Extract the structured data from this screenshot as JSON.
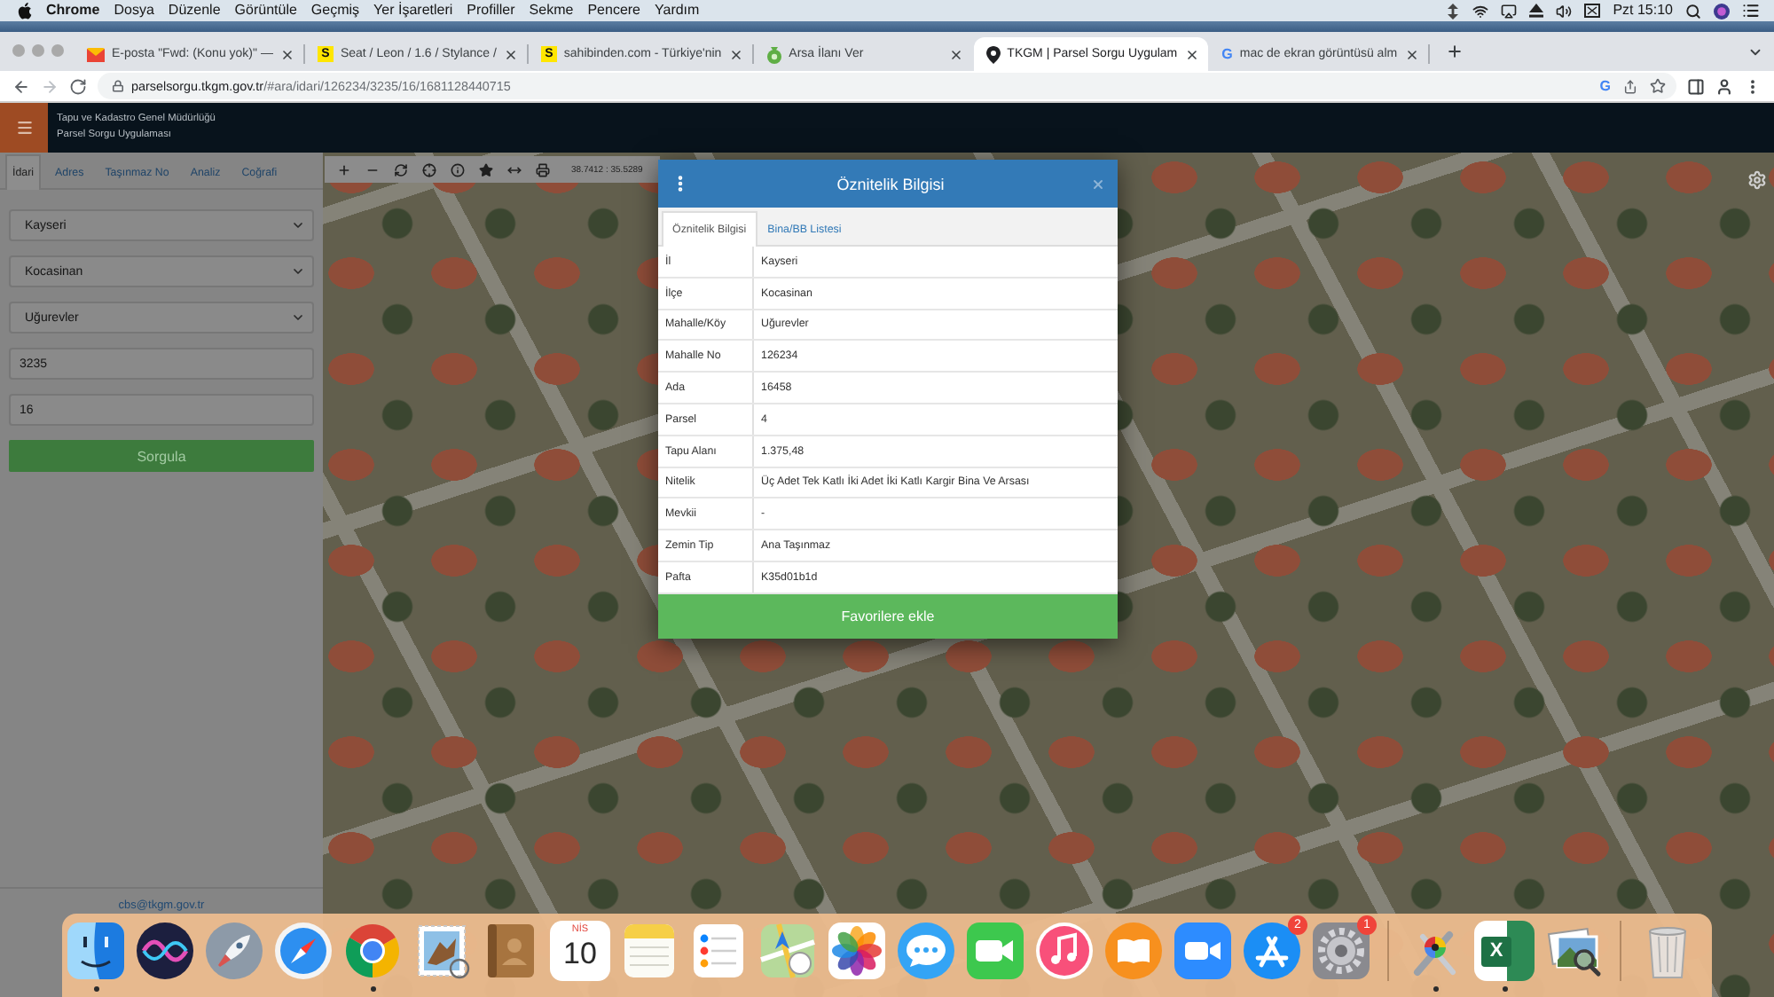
{
  "menu_bar": {
    "app_name": "Chrome",
    "menus": [
      "Dosya",
      "Düzenle",
      "Görüntüle",
      "Geçmiş",
      "Yer İşaretleri",
      "Profiller",
      "Sekme",
      "Pencere",
      "Yardım"
    ],
    "clock": "Pzt 15:10"
  },
  "browser": {
    "tabs": [
      {
        "kind": "mail",
        "title": "E-posta \"Fwd: (Konu yok)\" —",
        "selected": false
      },
      {
        "kind": "letter",
        "glyph": "S",
        "title": "Seat / Leon / 1.6 / Stylance /",
        "selected": false
      },
      {
        "kind": "letter",
        "glyph": "S",
        "title": "sahibinden.com - Türkiye'nin",
        "selected": false
      },
      {
        "kind": "bag",
        "title": "Arsa İlanı Ver",
        "selected": false
      },
      {
        "kind": "pin",
        "title": "TKGM | Parsel Sorgu Uygulam",
        "selected": true
      },
      {
        "kind": "google",
        "glyph": "G",
        "title": "mac de ekran görüntüsü alm",
        "selected": false
      }
    ],
    "nav": [
      {
        "kind": "back",
        "disabled": false
      },
      {
        "kind": "forward",
        "disabled": true
      },
      {
        "kind": "reload",
        "disabled": false
      }
    ],
    "address": {
      "host": "parselsorgu.tkgm.gov.tr",
      "path": "/#ara/idari/126234/3235/16/1681128440715",
      "badge": "G"
    }
  },
  "app_header": {
    "title": "Tapu ve Kadastro Genel Müdürlüğü",
    "subtitle": "Parsel Sorgu Uygulaması"
  },
  "search_panel": {
    "tabs": [
      {
        "label": "İdari",
        "selected": true
      },
      {
        "label": "Adres",
        "selected": false
      },
      {
        "label": "Taşınmaz No",
        "selected": false
      },
      {
        "label": "Analiz",
        "selected": false
      },
      {
        "label": "Coğrafi",
        "selected": false
      }
    ],
    "fields": [
      {
        "kind": "select",
        "value": "Kayseri"
      },
      {
        "kind": "select",
        "value": "Kocasinan"
      },
      {
        "kind": "select",
        "value": "Uğurevler"
      },
      {
        "kind": "input",
        "value": "3235"
      },
      {
        "kind": "input",
        "value": "16"
      }
    ],
    "submit": "Sorgula",
    "footer": "cbs@tkgm.gov.tr"
  },
  "map": {
    "coordinates": "38.7412 : 35.5289"
  },
  "dialog": {
    "title": "Öznitelik Bilgisi",
    "tabs": [
      {
        "label": "Öznitelik Bilgisi",
        "selected": true
      },
      {
        "label": "Bina/BB Listesi",
        "selected": false
      }
    ],
    "rows": [
      {
        "label": "İl",
        "value": "Kayseri"
      },
      {
        "label": "İlçe",
        "value": "Kocasinan"
      },
      {
        "label": "Mahalle/Köy",
        "value": "Uğurevler"
      },
      {
        "label": "Mahalle No",
        "value": "126234"
      },
      {
        "label": "Ada",
        "value": "16458"
      },
      {
        "label": "Parsel",
        "value": "4"
      },
      {
        "label": "Tapu Alanı",
        "value": "1.375,48"
      },
      {
        "label": "Nitelik",
        "value": "Üç Adet Tek Katlı İki Adet İki Katlı Kargir Bina Ve Arsası"
      },
      {
        "label": "Mevkii",
        "value": "-"
      },
      {
        "label": "Zemin Tip",
        "value": "Ana Taşınmaz"
      },
      {
        "label": "Pafta",
        "value": "K35d01b1d"
      }
    ],
    "action": "Favorilere ekle"
  },
  "dock": {
    "items": [
      {
        "kind": "finder",
        "running": true
      },
      {
        "kind": "siri",
        "running": false
      },
      {
        "kind": "launchpad",
        "running": false
      },
      {
        "kind": "safari",
        "running": false
      },
      {
        "kind": "chrome",
        "running": true
      },
      {
        "kind": "mail",
        "running": false
      },
      {
        "kind": "contacts",
        "running": false
      },
      {
        "kind": "calendar",
        "month": "NİS",
        "day": "10",
        "running": false
      },
      {
        "kind": "notes",
        "running": false
      },
      {
        "kind": "reminders",
        "running": false
      },
      {
        "kind": "maps",
        "running": false
      },
      {
        "kind": "photos",
        "running": false
      },
      {
        "kind": "messages",
        "running": false
      },
      {
        "kind": "facetime",
        "running": false
      },
      {
        "kind": "music",
        "running": false
      },
      {
        "kind": "books",
        "running": false
      },
      {
        "kind": "zoom",
        "running": false
      },
      {
        "kind": "appstore",
        "badge": "2",
        "running": false
      },
      {
        "kind": "preferences",
        "badge": "1",
        "running": false
      },
      {
        "kind": "separator"
      },
      {
        "kind": "utility",
        "running": true
      },
      {
        "kind": "excel",
        "glyph": "X",
        "running": true
      },
      {
        "kind": "preview",
        "running": false
      },
      {
        "kind": "separator"
      },
      {
        "kind": "trash",
        "running": false
      }
    ]
  }
}
